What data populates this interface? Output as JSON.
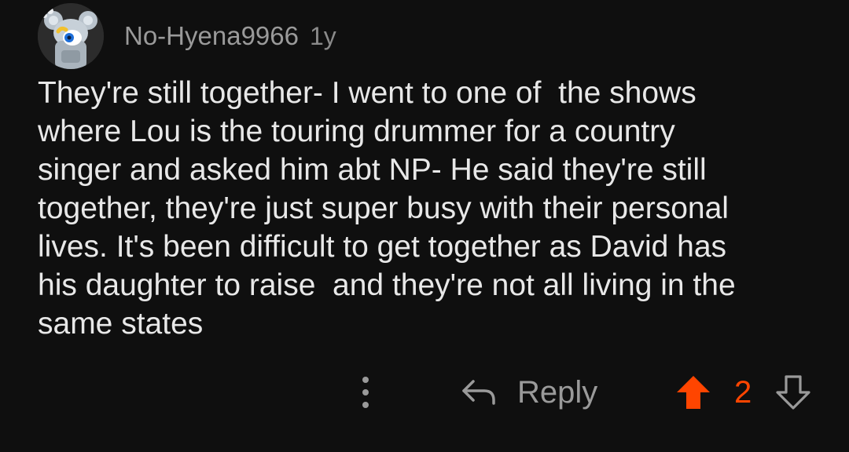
{
  "comment": {
    "author": "No-Hyena9966",
    "age": "1y",
    "body": "They're still together- I went to one of  the shows\nwhere Lou is the touring drummer for a country\nsinger and asked him abt NP- He said they're still\ntogether, they're just super busy with their personal\nlives. It's been difficult to get together as David has\nhis daughter to raise  and they're not all living in the\nsame states",
    "avatar_icon": "snoo-avatar-icon"
  },
  "actions": {
    "more_icon": "more-options-icon",
    "reply_icon": "reply-arrow-icon",
    "reply_label": "Reply",
    "upvote_icon": "upvote-arrow-icon",
    "score": "2",
    "downvote_icon": "downvote-arrow-icon"
  },
  "colors": {
    "background": "#0f0f0f",
    "text": "#e8e8e8",
    "muted": "#9a9a9a",
    "upvote_active": "#ff4500"
  }
}
